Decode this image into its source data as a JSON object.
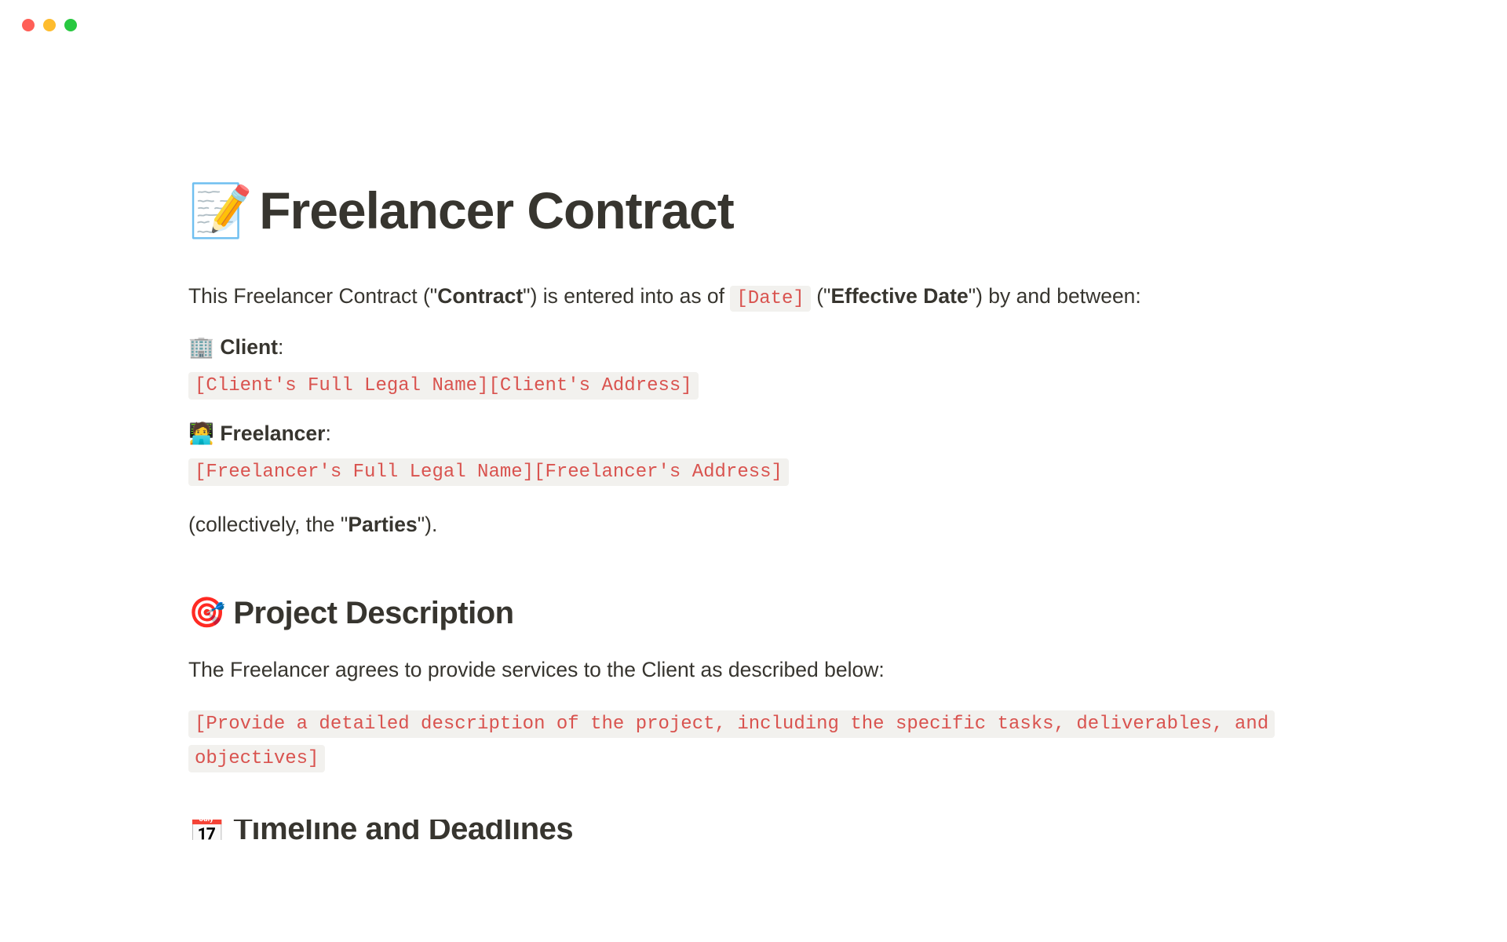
{
  "titleEmoji": "📝",
  "title": "Freelancer Contract",
  "intro": {
    "part1": "This Freelancer Contract (\"",
    "strong1": "Contract",
    "part2": "\") is entered into as of ",
    "datePlaceholder": "[Date]",
    "part3": " (\"",
    "strong2": "Effective Date",
    "part4": "\") by and between:"
  },
  "client": {
    "emoji": "🏢",
    "label": "Client",
    "placeholder": "[Client's Full Legal Name][Client's Address]"
  },
  "freelancer": {
    "emoji": "🧑‍💻",
    "label": "Freelancer",
    "placeholder": "[Freelancer's Full Legal Name][Freelancer's Address]"
  },
  "parties": {
    "part1": "(collectively, the \"",
    "strong": "Parties",
    "part2": "\")."
  },
  "projectDescription": {
    "emoji": "🎯",
    "heading": "Project Description",
    "intro": "The Freelancer agrees to provide services to the Client as described below:",
    "placeholder": "[Provide a detailed description of the project, including the specific tasks, deliverables, and objectives]"
  },
  "nextSection": {
    "emoji": "📅",
    "heading": "Timeline and Deadlines"
  }
}
